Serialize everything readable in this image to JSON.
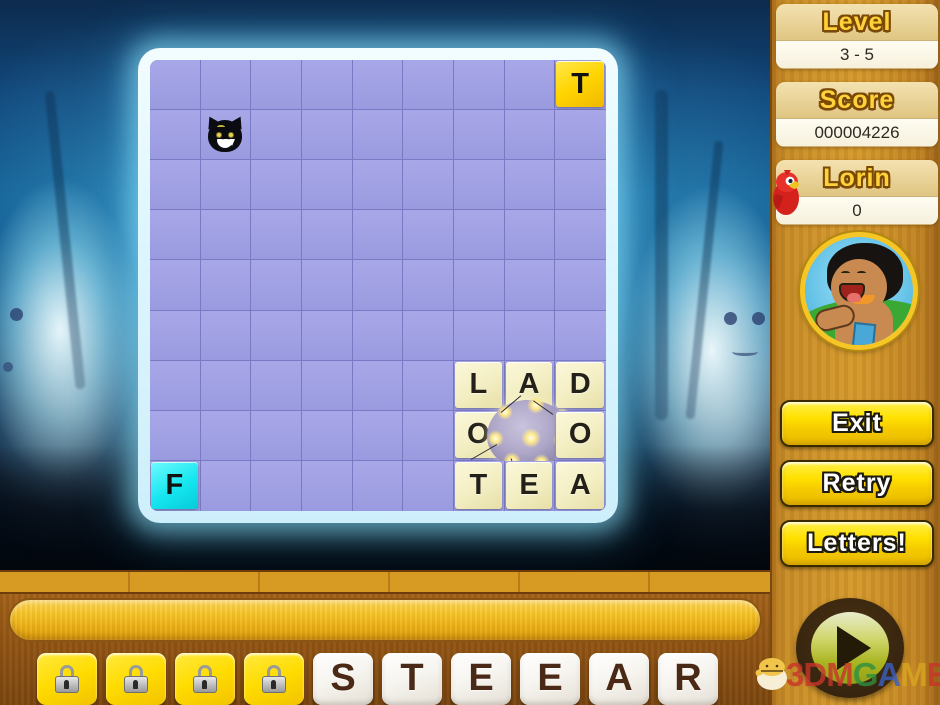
{
  "panel": {
    "level_header": "Level",
    "level_value": "3 - 5",
    "score_header": "Score",
    "score_value": "000004226",
    "lorin_header": "Lorin",
    "lorin_value": "0",
    "buttons": [
      {
        "label": "Exit",
        "name": "exit-button"
      },
      {
        "label": "Retry",
        "name": "retry-button"
      },
      {
        "label": "Letters!",
        "name": "letters-button"
      }
    ],
    "play_icon": "play-triangle-icon",
    "parrot_icon": "parrot-icon",
    "avatar_icon": "lorin-avatar-portrait"
  },
  "board": {
    "columns": 9,
    "rows": 9,
    "tiles": [
      {
        "row": 0,
        "col": 8,
        "letter": "T",
        "style": "yellow"
      },
      {
        "row": 6,
        "col": 6,
        "letter": "L",
        "style": "cream"
      },
      {
        "row": 6,
        "col": 7,
        "letter": "A",
        "style": "cream"
      },
      {
        "row": 6,
        "col": 8,
        "letter": "D",
        "style": "cream"
      },
      {
        "row": 7,
        "col": 6,
        "letter": "O",
        "style": "cream"
      },
      {
        "row": 7,
        "col": 8,
        "letter": "O",
        "style": "cream"
      },
      {
        "row": 8,
        "col": 0,
        "letter": "F",
        "style": "cyan"
      },
      {
        "row": 8,
        "col": 6,
        "letter": "T",
        "style": "cream"
      },
      {
        "row": 8,
        "col": 7,
        "letter": "E",
        "style": "cream"
      },
      {
        "row": 8,
        "col": 8,
        "letter": "A",
        "style": "cream"
      }
    ],
    "monster": {
      "row": 1,
      "col": 1,
      "icon": "monster-icon"
    },
    "explosion": {
      "row": 7,
      "col": 7,
      "icon": "explosion-effect"
    }
  },
  "rack": {
    "locked_count": 4,
    "lock_icon": "lock-icon",
    "letters": [
      "S",
      "T",
      "E",
      "E",
      "A",
      "R"
    ]
  },
  "watermark": {
    "text_parts": [
      {
        "t": "3",
        "color": "#c9342a"
      },
      {
        "t": "D",
        "color": "#c9342a"
      },
      {
        "t": "M",
        "color": "#c9342a"
      },
      {
        "t": "G",
        "color": "#2f8f3f"
      },
      {
        "t": "A",
        "color": "#3a5fc0"
      },
      {
        "t": "M",
        "color": "#d9a520"
      },
      {
        "t": "E",
        "color": "#c9342a"
      }
    ],
    "bird_icon": "bird-mascot-icon"
  },
  "colors": {
    "board_cell": "#9a9ae0",
    "tile_yellow": "#ffd400",
    "tile_cyan": "#16e6ef",
    "tile_cream": "#f3eec2",
    "panel_wood": "#d69a2c",
    "button_yellow": "#ffe000"
  }
}
